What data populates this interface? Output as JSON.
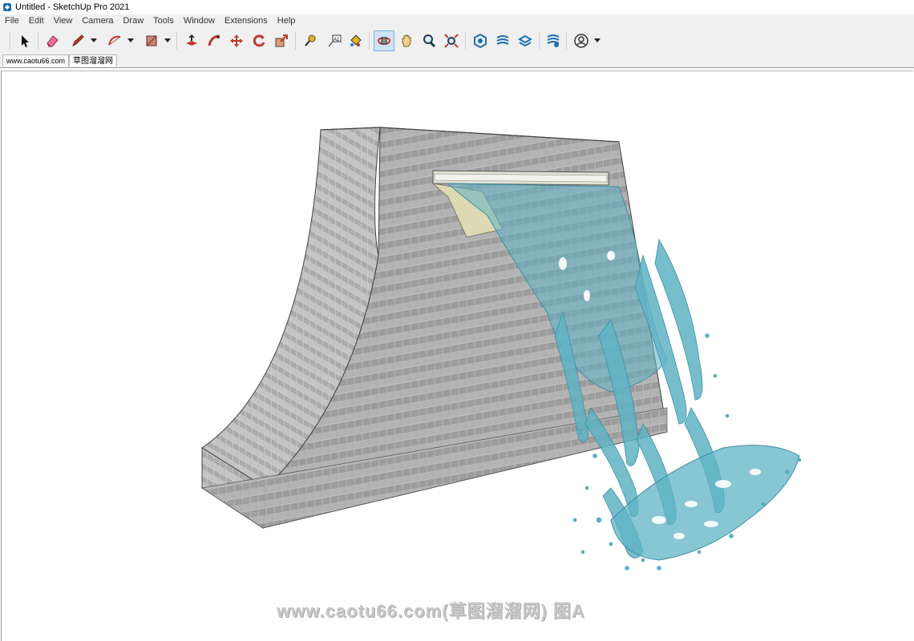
{
  "window": {
    "title": "Untitled - SketchUp Pro 2021"
  },
  "menu": [
    "File",
    "Edit",
    "View",
    "Camera",
    "Draw",
    "Tools",
    "Window",
    "Extensions",
    "Help"
  ],
  "toolbar": {
    "tools": [
      {
        "name": "select-tool-button",
        "icon": "arrow-cursor-icon"
      },
      {
        "name": "eraser-tool-button",
        "icon": "eraser-icon"
      },
      {
        "name": "line-tool-button",
        "icon": "pencil-icon"
      },
      {
        "name": "arc-tool-button",
        "icon": "arc-icon"
      },
      {
        "name": "shape-tool-button",
        "icon": "rectangle-icon"
      },
      {
        "name": "push-pull-tool-button",
        "icon": "push-pull-icon"
      },
      {
        "name": "follow-me-tool-button",
        "icon": "follow-me-icon"
      },
      {
        "name": "move-tool-button",
        "icon": "move-icon"
      },
      {
        "name": "rotate-tool-button",
        "icon": "rotate-icon"
      },
      {
        "name": "scale-tool-button",
        "icon": "scale-icon"
      },
      {
        "name": "tape-measure-tool-button",
        "icon": "tape-measure-icon"
      },
      {
        "name": "text-tool-button",
        "icon": "text-label-icon"
      },
      {
        "name": "paint-bucket-tool-button",
        "icon": "paint-bucket-icon"
      },
      {
        "name": "orbit-tool-button",
        "icon": "orbit-icon"
      },
      {
        "name": "pan-tool-button",
        "icon": "pan-hand-icon"
      },
      {
        "name": "zoom-tool-button",
        "icon": "magnifier-icon"
      },
      {
        "name": "zoom-extents-tool-button",
        "icon": "zoom-extents-icon"
      },
      {
        "name": "warehouse-button",
        "icon": "3d-warehouse-icon"
      },
      {
        "name": "extension-warehouse-button",
        "icon": "extension-warehouse-icon"
      },
      {
        "name": "layout-button",
        "icon": "layout-icon"
      },
      {
        "name": "extension-manager-button",
        "icon": "extension-manager-icon"
      },
      {
        "name": "account-button",
        "icon": "user-account-icon"
      }
    ],
    "text_tool_glyph": "A1"
  },
  "tabs": [
    {
      "label": "www.caotu66.com",
      "active": false
    },
    {
      "label": "草图溜溜网",
      "active": true
    }
  ],
  "watermark": "www.caotu66.com(草图溜溜网) 图A",
  "colors": {
    "wall": "#a9a9a9",
    "water": "#5fb3c4",
    "water_dark": "#3d8fa3",
    "active_tool": "#cfe3f5"
  }
}
